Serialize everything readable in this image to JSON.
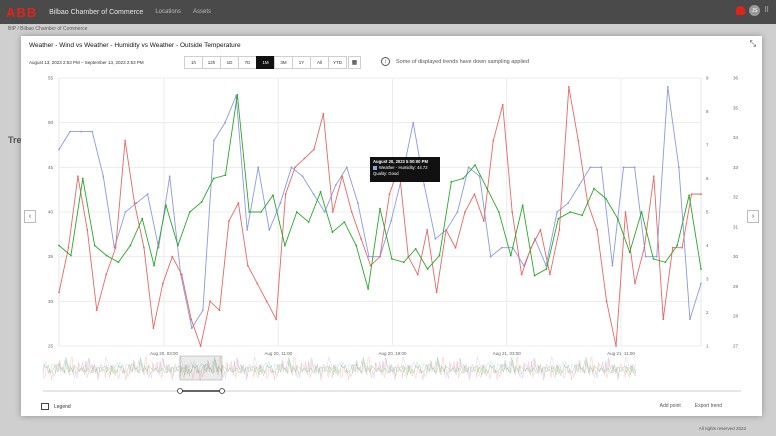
{
  "app": {
    "logo": "ABB",
    "name": "Bilbao Chamber of Commerce",
    "nav": [
      "Locations",
      "Assets"
    ],
    "avatar": "JS"
  },
  "background": {
    "breadcrumb": "BIP / Bilbao Chamber of Commerce",
    "left_heading": "Tre",
    "footer": "All rights reserved 2023"
  },
  "modal": {
    "title": "Weather - Wind vs Weather - Humidity vs Weather - Outside Temperature",
    "date_range": "August 13, 2023 2:53 PM – September 13, 2023 2:53 PM",
    "ranges": [
      "1h",
      "12h",
      "1D",
      "7D",
      "1M",
      "3M",
      "1Y",
      "All",
      "YTD"
    ],
    "active_range": "1M",
    "info_text": "Some of displayed trends have down sampling applied",
    "legend_label": "Legend",
    "add_point": "Add point",
    "export_trend": "Export trend"
  },
  "tooltip": {
    "time": "August 20, 2023 5:00:00 PM",
    "series_line": "Weather - Humidity: 44.72",
    "quality": "Quality: Good"
  },
  "chart_data": {
    "type": "line",
    "x_ticks": [
      "Aug 20, 03:00",
      "Aug 20, 11:00",
      "Aug 20, 19:00",
      "Aug 21, 03:00",
      "Aug 21, 11:00"
    ],
    "left_axis": {
      "ylim": [
        25,
        55
      ],
      "ticks": [
        25,
        30,
        35,
        40,
        45,
        50,
        55
      ]
    },
    "right_axis_1": {
      "ylim": [
        1,
        9
      ],
      "ticks": [
        1,
        2,
        3,
        4,
        5,
        6,
        7,
        8,
        9
      ]
    },
    "right_axis_2": {
      "ylim": [
        27,
        36
      ],
      "ticks": [
        27,
        28,
        29,
        30,
        31,
        32,
        33,
        34,
        35,
        36
      ]
    },
    "series": [
      {
        "color": "#8b9ae0",
        "axis": "left",
        "values": [
          47,
          49,
          49,
          49,
          44,
          36,
          40,
          41,
          42,
          36,
          44,
          33,
          27,
          29,
          48,
          50,
          53,
          38,
          45,
          38,
          41,
          45,
          44,
          42,
          40,
          43,
          45,
          41,
          35,
          35,
          39,
          44,
          50,
          43,
          37,
          38,
          40,
          45,
          44,
          35,
          36,
          36,
          34,
          37,
          34,
          40,
          41,
          43,
          45,
          45,
          34,
          45,
          45,
          35,
          35,
          54,
          45,
          28,
          32
        ]
      },
      {
        "color": "#e56868",
        "axis": "left",
        "values": [
          31,
          36,
          44,
          38,
          29,
          33,
          36,
          48,
          41,
          36,
          27,
          32,
          35,
          33,
          28,
          25,
          30,
          29,
          39,
          41,
          34,
          32,
          30,
          28,
          42,
          45,
          46,
          47,
          51,
          40,
          44,
          40,
          37,
          34,
          35,
          42,
          45,
          35,
          33,
          38,
          31,
          38,
          36,
          40,
          42,
          39,
          48,
          52,
          40,
          33,
          36,
          38,
          33,
          38,
          54,
          48,
          41,
          38,
          30,
          25,
          40,
          32,
          36,
          44,
          28,
          36,
          36,
          42,
          42
        ]
      },
      {
        "color": "#2aa82a",
        "axis": "right_1",
        "values": [
          4,
          3.7,
          6,
          4,
          3.7,
          3.5,
          4,
          4.8,
          3.4,
          5.2,
          4,
          5,
          5.3,
          6,
          6.1,
          8.5,
          5,
          5,
          5.5,
          4,
          5,
          4.7,
          5.6,
          4.4,
          4.7,
          4,
          2.7,
          5.1,
          3.6,
          3.5,
          3.9,
          3.3,
          3.7,
          5.9,
          6,
          6.4,
          5.7,
          5,
          3.7,
          5.2,
          3.1,
          3.3,
          4.8,
          5,
          4.9,
          5.7,
          5.4,
          4.8,
          3.8,
          5,
          3.6,
          3.5,
          4,
          5.5,
          3.3
        ]
      }
    ]
  }
}
